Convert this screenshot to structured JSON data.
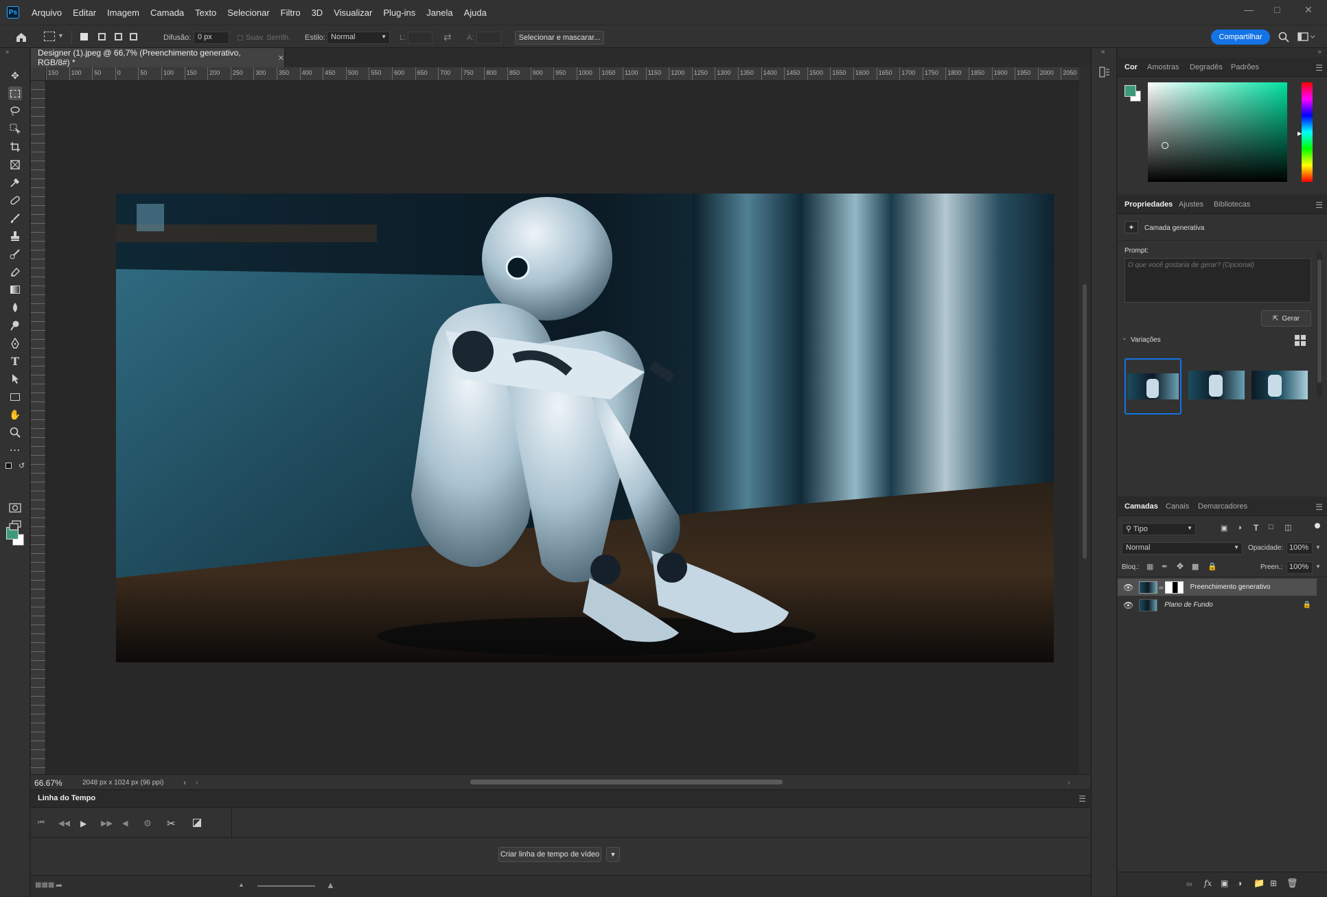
{
  "app": {
    "logo": "Ps"
  },
  "menu": [
    "Arquivo",
    "Editar",
    "Imagem",
    "Camada",
    "Texto",
    "Selecionar",
    "Filtro",
    "3D",
    "Visualizar",
    "Plug-ins",
    "Janela",
    "Ajuda"
  ],
  "options": {
    "feather_label": "Difusão:",
    "feather_value": "0 px",
    "antialias_label": "Suav. Serrilh.",
    "style_label": "Estilo:",
    "style_value": "Normal",
    "width_label": "L:",
    "height_label": "A:",
    "select_mask": "Selecionar e mascarar...",
    "share": "Compartilhar"
  },
  "document": {
    "tab_title": "Designer (1).jpeg @ 66,7% (Preenchimento generativo, RGB/8#) *",
    "zoom": "66.67%",
    "dimensions": "2048 px x 1024 px (96 ppi)",
    "ruler_ticks": [
      "150",
      "100",
      "50",
      "0",
      "50",
      "100",
      "150",
      "200",
      "250",
      "300",
      "350",
      "400",
      "450",
      "500",
      "550",
      "600",
      "650",
      "700",
      "750",
      "800",
      "850",
      "900",
      "950",
      "1000",
      "1050",
      "1100",
      "1150",
      "1200",
      "1250",
      "1300",
      "1350",
      "1400",
      "1450",
      "1500",
      "1550",
      "1600",
      "1650",
      "1700",
      "1750",
      "1800",
      "1850",
      "1900",
      "1950",
      "2000",
      "2050"
    ]
  },
  "timeline": {
    "title": "Linha do Tempo",
    "create_button": "Criar linha de tempo de vídeo"
  },
  "color_panel": {
    "tabs": [
      "Cor",
      "Amostras",
      "Degradês",
      "Padrões"
    ],
    "foreground": "#3c9a7a",
    "hue_color": "#00e0a0"
  },
  "properties_panel": {
    "tabs": [
      "Propriedades",
      "Ajustes",
      "Bibliotecas"
    ],
    "layer_type": "Camada generativa",
    "prompt_label": "Prompt:",
    "prompt_placeholder": "O que você gostaria de gerar? (Opcional)",
    "generate_button": "Gerar",
    "variations_label": "Variações"
  },
  "layers_panel": {
    "tabs": [
      "Camadas",
      "Canais",
      "Demarcadores"
    ],
    "filter": "Tipo",
    "blend_mode": "Normal",
    "opacity_label": "Opacidade:",
    "opacity_value": "100%",
    "lock_label": "Bloq.:",
    "fill_label": "Preen.:",
    "fill_value": "100%",
    "layers": [
      {
        "name": "Preenchimento generativo",
        "selected": true
      },
      {
        "name": "Plano de Fundo",
        "selected": false,
        "locked": true
      }
    ]
  }
}
